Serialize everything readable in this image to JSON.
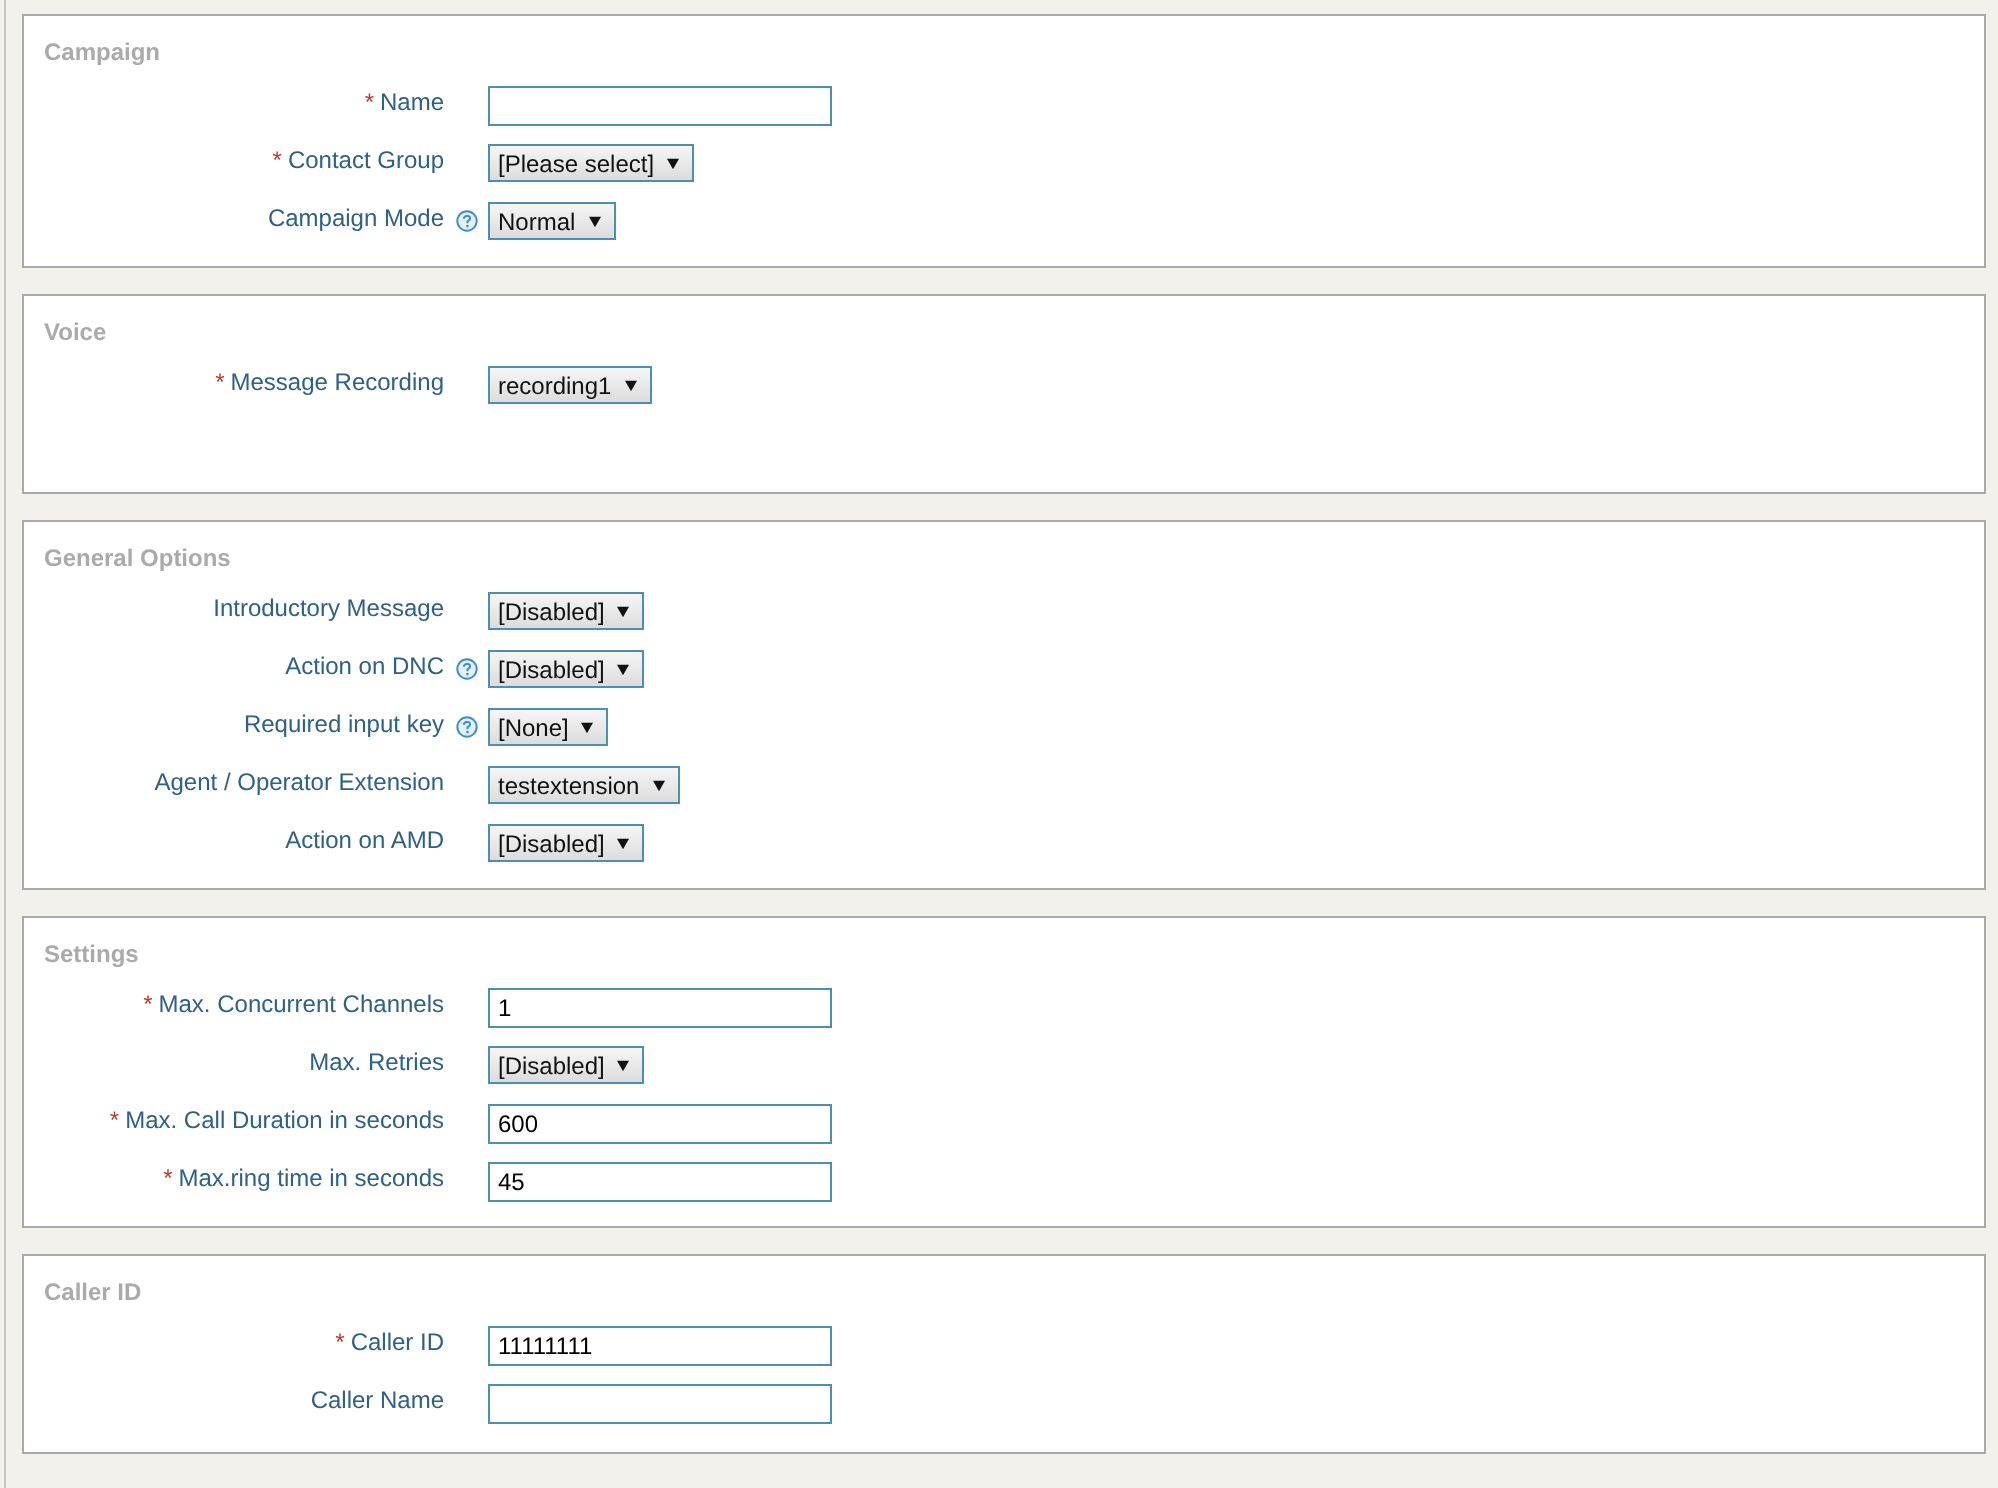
{
  "sections": [
    {
      "title": "Campaign",
      "fields": [
        {
          "marker": "*",
          "label": "Name",
          "kind": "text",
          "help": false
        },
        {
          "marker": "*",
          "label": "Contact Group",
          "kind": "select",
          "help": false,
          "value": "[Please select]"
        },
        {
          "label": "Campaign Mode",
          "kind": "select",
          "help": true,
          "value": "Normal"
        }
      ]
    },
    {
      "title": "Voice",
      "fields": [
        {
          "marker": "*",
          "label": "Message Recording",
          "kind": "select",
          "help": false,
          "value": "recording1"
        }
      ]
    },
    {
      "title": "General Options",
      "fields": [
        {
          "label": "Introductory Message",
          "kind": "select",
          "help": false,
          "value": "[Disabled]"
        },
        {
          "label": "Action on DNC",
          "kind": "select",
          "help": true,
          "value": "[Disabled]"
        },
        {
          "label": "Required input key",
          "kind": "select",
          "help": true,
          "value": "[None]"
        },
        {
          "label": "Agent / Operator Extension",
          "kind": "select",
          "help": false,
          "value": "testextension"
        },
        {
          "label": "Action on AMD",
          "kind": "select",
          "help": false,
          "value": "[Disabled]"
        }
      ]
    },
    {
      "title": "Settings",
      "fields": [
        {
          "marker": "*",
          "label": "Max. Concurrent Channels",
          "kind": "text",
          "help": false,
          "value": "1"
        },
        {
          "label": "Max. Retries",
          "kind": "select",
          "help": false,
          "value": "[Disabled]"
        },
        {
          "marker": "*",
          "label": "Max. Call Duration in seconds",
          "kind": "text",
          "help": false,
          "value": "600"
        },
        {
          "marker": "*",
          "label": "Max.ring time in seconds",
          "kind": "text",
          "help": false,
          "value": "45"
        }
      ]
    },
    {
      "title": "Caller ID",
      "fields": [
        {
          "marker": "*",
          "label": "Caller ID",
          "kind": "text",
          "help": false,
          "value": "11111111"
        },
        {
          "label": "Caller Name",
          "kind": "text",
          "help": false
        }
      ]
    }
  ]
}
